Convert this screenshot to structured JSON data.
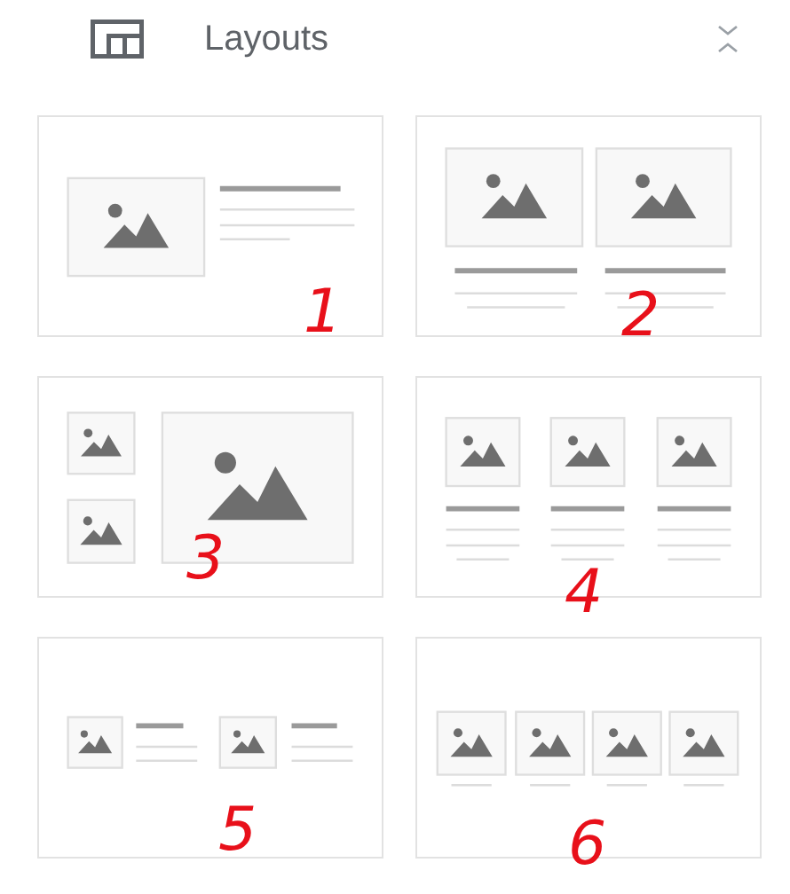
{
  "panel": {
    "title": "Layouts"
  },
  "layouts": [
    {
      "kind": "image-left-text",
      "annotation": "1"
    },
    {
      "kind": "two-columns",
      "annotation": "2"
    },
    {
      "kind": "image-grid",
      "annotation": "3"
    },
    {
      "kind": "three-columns",
      "annotation": "4"
    },
    {
      "kind": "two-image-rows",
      "annotation": "5"
    },
    {
      "kind": "four-columns",
      "annotation": "6"
    }
  ]
}
